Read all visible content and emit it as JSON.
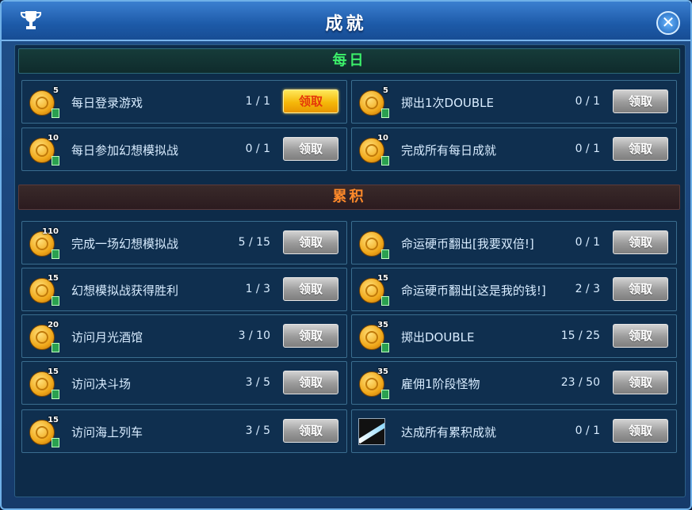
{
  "window": {
    "title": "成就",
    "close_label": "✕"
  },
  "sections": {
    "daily_label": "每日",
    "cumulative_label": "累积"
  },
  "daily": [
    {
      "name": "每日登录游戏",
      "progress": "1 / 1",
      "reward": "5",
      "claimable": true
    },
    {
      "name": "掷出1次DOUBLE",
      "progress": "0 / 1",
      "reward": "5",
      "claimable": false
    },
    {
      "name": "每日参加幻想模拟战",
      "progress": "0 / 1",
      "reward": "10",
      "claimable": false
    },
    {
      "name": "完成所有每日成就",
      "progress": "0 / 1",
      "reward": "10",
      "claimable": false
    }
  ],
  "cumulative": [
    {
      "name": "完成一场幻想模拟战",
      "progress": "5 / 15",
      "reward": "110",
      "claimable": false
    },
    {
      "name": "命运硬币翻出[我要双倍!]",
      "progress": "0 / 1",
      "reward": "",
      "claimable": false
    },
    {
      "name": "幻想模拟战获得胜利",
      "progress": "1 / 3",
      "reward": "15",
      "claimable": false
    },
    {
      "name": "命运硬币翻出[这是我的钱!]",
      "progress": "2 / 3",
      "reward": "15",
      "claimable": false
    },
    {
      "name": "访问月光酒馆",
      "progress": "3 / 10",
      "reward": "20",
      "claimable": false
    },
    {
      "name": "掷出DOUBLE",
      "progress": "15 / 25",
      "reward": "35",
      "claimable": false
    },
    {
      "name": "访问决斗场",
      "progress": "3 / 5",
      "reward": "15",
      "claimable": false
    },
    {
      "name": "雇佣1阶段怪物",
      "progress": "23 / 50",
      "reward": "35",
      "claimable": false
    },
    {
      "name": "访问海上列车",
      "progress": "3 / 5",
      "reward": "15",
      "claimable": false
    },
    {
      "name": "达成所有累积成就",
      "progress": "0 / 1",
      "reward": "",
      "claimable": false,
      "icon": "dark-slash-icon"
    }
  ],
  "claim_label": "领取",
  "colors": {
    "claim_active": "#f5b80a",
    "claim_disabled": "#9a9a9a",
    "daily_header": "#3cf06a",
    "cumulative_header": "#ff8a2a"
  }
}
